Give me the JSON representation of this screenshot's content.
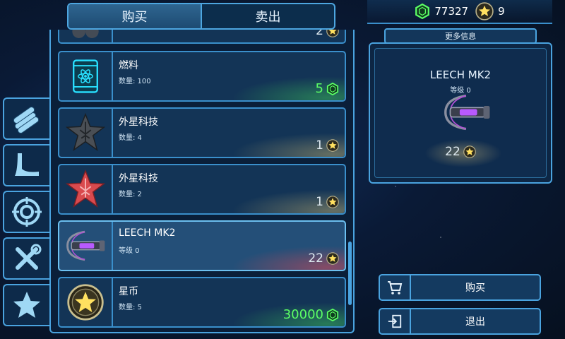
{
  "tabs": {
    "buy": "购买",
    "sell": "卖出",
    "active": "buy"
  },
  "currency": {
    "gems": "77327",
    "stars": "9"
  },
  "partial_row": {
    "price": "2"
  },
  "items": [
    {
      "name": "燃料",
      "sub": "数量: 100",
      "price": "5",
      "currency": "gem",
      "icon": "fuel-barrel-icon"
    },
    {
      "name": "外星科技",
      "sub": "数量: 4",
      "price": "1",
      "currency": "star",
      "icon": "gray-alien-tech-star-icon"
    },
    {
      "name": "外星科技",
      "sub": "数量: 2",
      "price": "1",
      "currency": "star",
      "icon": "red-alien-tech-star-icon"
    },
    {
      "name": "LEECH MK2",
      "sub": "等级 0",
      "price": "22",
      "currency": "star",
      "icon": "leech-weapon-icon",
      "selected": true
    },
    {
      "name": "星币",
      "sub": "数量: 5",
      "price": "30000",
      "currency": "gem",
      "icon": "star-coin-icon"
    }
  ],
  "categories": [
    "materials-category",
    "hook-category",
    "target-category",
    "tools-category",
    "star-category"
  ],
  "detail": {
    "label": "更多信息",
    "title": "LEECH MK2",
    "level": "等级 0",
    "price": "22"
  },
  "buttons": {
    "buy": "购买",
    "exit": "退出"
  },
  "colors": {
    "accent": "#4aa3df",
    "gem_green": "#5cff65",
    "star_gold": "#ffe060"
  }
}
